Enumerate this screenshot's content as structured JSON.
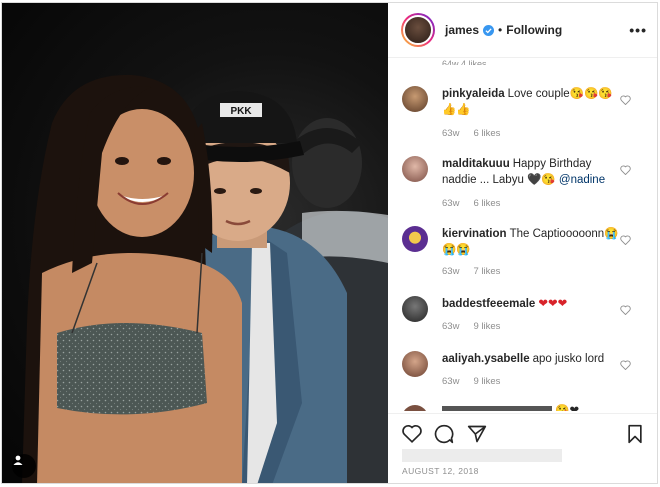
{
  "post": {
    "username": "james",
    "follow_status": "Following",
    "more_icon": "more-horizontal-icon",
    "date": "AUGUST 12, 2018"
  },
  "comments": {
    "cut_off_meta": "64w   4 likes",
    "items": [
      {
        "username": "pinkyaleida",
        "text": "Love couple",
        "emoji": "😘😘😘👍👍",
        "age": "63w",
        "likes": "6 likes",
        "avatar_color": "#8a5a3c"
      },
      {
        "username": "malditakuuu",
        "text": "Happy Birthday naddie ... Labyu",
        "emoji": "🖤😘",
        "mention": "@nadine",
        "age": "63w",
        "likes": "6 likes",
        "avatar_color": "#b07a6a"
      },
      {
        "username": "kiervination",
        "text": "The Captiooooonn",
        "emoji": "😭😭😭",
        "age": "63w",
        "likes": "7 likes",
        "avatar_color": "#5b2e91"
      },
      {
        "username": "baddestfeeemale",
        "text": "",
        "emoji": "❤❤❤",
        "age": "63w",
        "likes": "9 likes",
        "avatar_color": "#3a3a3a"
      },
      {
        "username": "aaliyah.ysabelle",
        "text": "apo jusko lord",
        "emoji": "",
        "age": "63w",
        "likes": "9 likes",
        "avatar_color": "#9b6b55"
      }
    ],
    "partial_emoji": "😘❤"
  },
  "colors": {
    "verified_blue": "#3897f0",
    "mention": "#003569",
    "meta_gray": "#8e8e8e"
  }
}
